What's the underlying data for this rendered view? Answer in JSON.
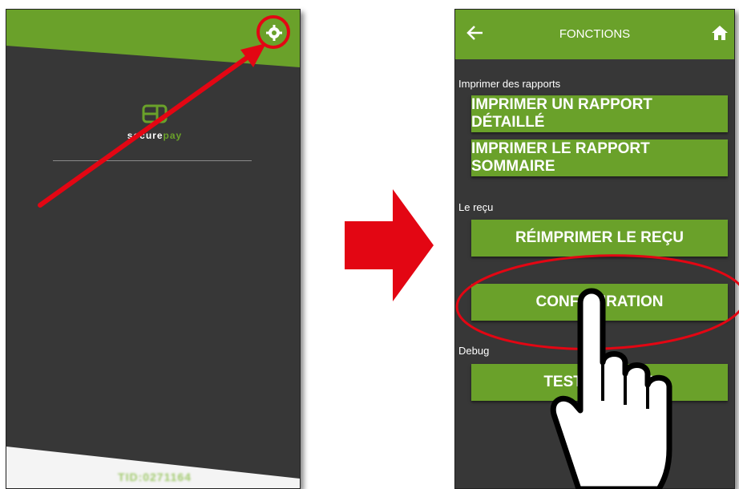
{
  "left_screen": {
    "brand_prefix": "secure",
    "brand_suffix": "pay",
    "footer_text": "TID:0271164"
  },
  "right_screen": {
    "header": {
      "title": "FONCTIONS"
    },
    "sections": [
      {
        "label": "Imprimer des rapports",
        "buttons": [
          "IMPRIMER UN RAPPORT DÉTAILLÉ",
          "IMPRIMER LE RAPPORT SOMMAIRE"
        ]
      },
      {
        "label": "Le reçu",
        "buttons": [
          "RÉIMPRIMER LE REÇU",
          "CONFIGURATION"
        ]
      },
      {
        "label": "Debug",
        "buttons": [
          "TEST DE LOGS"
        ]
      }
    ]
  },
  "colors": {
    "brand_green": "#6aa12a",
    "background": "#373737",
    "annotation_red": "#e30613"
  }
}
